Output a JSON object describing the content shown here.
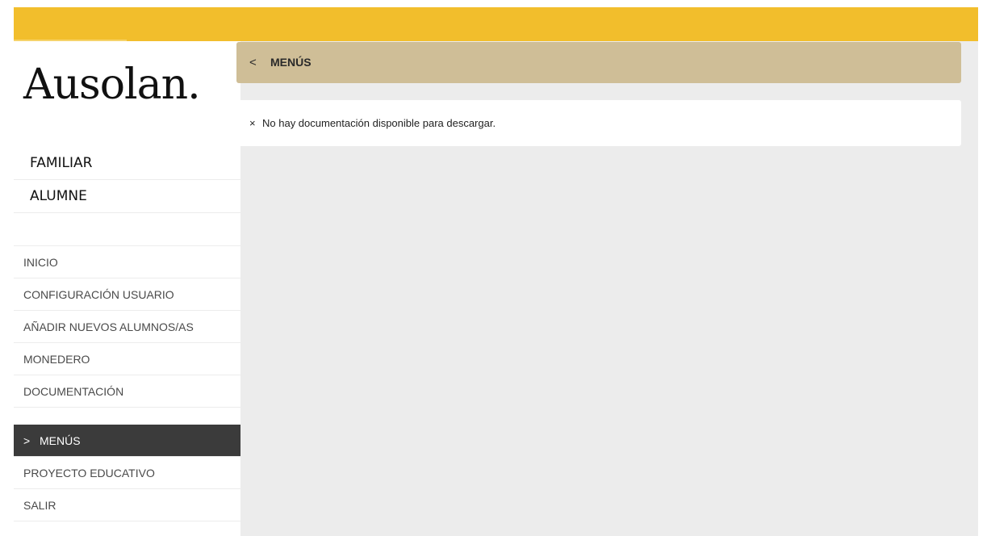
{
  "topbar": {
    "tag_text": ""
  },
  "logo": {
    "text": "Ausolan."
  },
  "users": [
    {
      "label": "FAMILIAR"
    },
    {
      "label": "ALUMNE"
    }
  ],
  "nav": {
    "items": [
      {
        "label": "INICIO"
      },
      {
        "label": "CONFIGURACIÓN USUARIO"
      },
      {
        "label": "AÑADIR NUEVOS ALUMNOS/AS"
      },
      {
        "label": "MONEDERO"
      },
      {
        "label": "DOCUMENTACIÓN"
      },
      {
        "label": "MENÚS",
        "active": true
      },
      {
        "label": "PROYECTO EDUCATIVO"
      },
      {
        "label": "SALIR"
      }
    ],
    "active_chevron": ">"
  },
  "header": {
    "back_symbol": "<",
    "title": "MENÚS"
  },
  "notice": {
    "symbol": "×",
    "text": "No hay documentación disponible para descargar."
  },
  "colors": {
    "topbar": "#f2be2c",
    "header_card": "#cfbe97",
    "active_nav": "#3b3b3b",
    "content_bg": "#ececec"
  }
}
